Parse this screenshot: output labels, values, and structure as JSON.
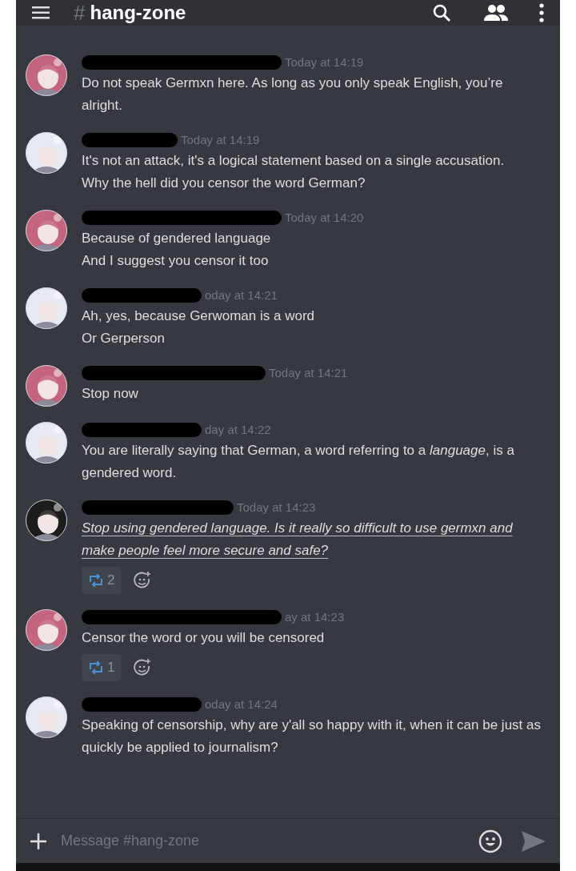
{
  "header": {
    "hash": "#",
    "channel": "hang-zone"
  },
  "messages": [
    {
      "color": "#c4647e",
      "time": "Today at 14:19",
      "lines": [
        "Do not speak Germxn here. As long as you only speak English, you’re alright."
      ]
    },
    {
      "color": "#e6eaf2",
      "time": "Today at 14:19",
      "lines": [
        "It's not an attack, it's a logical statement based on a single accusation.",
        "Why the hell did you censor the word German?"
      ]
    },
    {
      "color": "#c4647e",
      "time": "Today at 14:20",
      "lines": [
        "Because of gendered language",
        "And I suggest you censor it too"
      ]
    },
    {
      "color": "#e6eaf2",
      "time": "oday at 14:21",
      "lines": [
        "Ah, yes, because Gerwoman is a word",
        "Or Gerperson"
      ]
    },
    {
      "color": "#c4647e",
      "time": "Today at 14:21",
      "lines": [
        "Stop now"
      ]
    },
    {
      "color": "#e6eaf2",
      "time": "day at 14:22",
      "lines": [
        "You are literally saying that German, a word referring to a *language*, is a gendered word."
      ]
    },
    {
      "color": "#1c1c1c",
      "time": "Today at 14:23",
      "kind": "emphasis",
      "lines": [
        "Stop using gendered language. Is it really so difficult to use germxn and make people feel more secure and safe?"
      ],
      "reactions": [
        {
          "count": "2"
        }
      ]
    },
    {
      "color": "#c4647e",
      "time": "ay at 14:23",
      "lines": [
        "Censor the word or you will be censored"
      ],
      "reactions": [
        {
          "count": "1"
        }
      ]
    },
    {
      "color": "#e6eaf2",
      "time": "oday at 14:24",
      "lines": [
        "Speaking of censorship, why are y'all so happy with it, when it can be just as quickly be applied to journalism?"
      ]
    }
  ],
  "composer": {
    "placeholder": "Message #hang-zone"
  }
}
